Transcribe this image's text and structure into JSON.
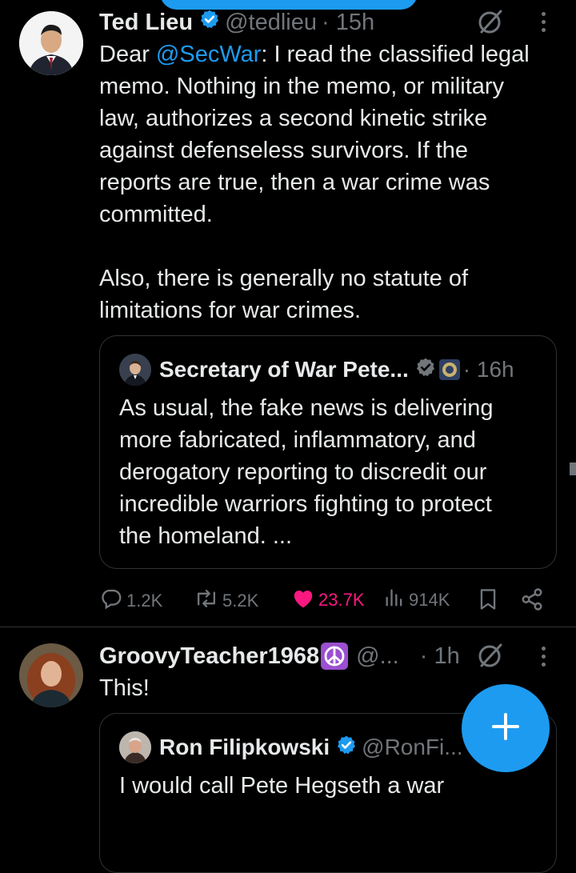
{
  "tweet1": {
    "display_name": "Ted Lieu",
    "handle": "@tedlieu",
    "time": "· 15h",
    "body_lines": [
      [
        "Dear ",
        "@SecWar",
        ": I read the classified legal"
      ],
      "memo. Nothing in the memo, or military",
      "law, authorizes a second kinetic strike",
      "against defenseless survivors. If the",
      "reports are true, then a war crime was",
      "committed.",
      "",
      "Also, there is generally no statute of",
      "limitations for war crimes."
    ],
    "quote": {
      "display_name": "Secretary of War Pete...",
      "time": "· 16h",
      "body_lines": [
        "As usual, the fake news is delivering",
        "more fabricated, inflammatory, and",
        "derogatory reporting to discredit our",
        "incredible warriors fighting to protect",
        "the homeland. ..."
      ]
    },
    "actions": {
      "replies": "1.2K",
      "reposts": "5.2K",
      "likes": "23.7K",
      "views": "914K"
    }
  },
  "tweet2": {
    "display_name": "GroovyTeacher1968",
    "handle": "@...",
    "time": "· 1h",
    "body": "This!",
    "quote": {
      "display_name": "Ron Filipkowski",
      "handle": "@RonFi...",
      "body_line": "I would call Pete Hegseth a war"
    }
  },
  "colors": {
    "accent": "#1d9bf0",
    "like": "#f91880",
    "muted": "#71767b",
    "text": "#e7e9ea",
    "background": "#000000"
  },
  "icons": [
    "verified-badge-icon",
    "grok-slash-icon",
    "more-icon",
    "reply-icon",
    "repost-icon",
    "like-icon",
    "views-icon",
    "bookmark-icon",
    "share-icon",
    "compose-plus-icon",
    "peace-icon",
    "seal-icon"
  ]
}
